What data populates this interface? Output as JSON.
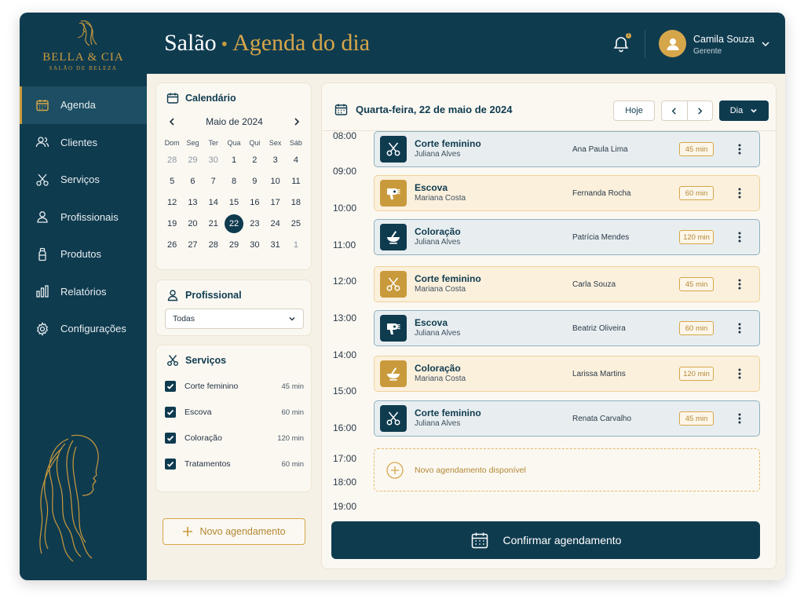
{
  "brand": {
    "name": "BELLA & CIA",
    "subtitle": "SALÃO DE BELEZA"
  },
  "nav": {
    "items": [
      {
        "label": "Agenda",
        "icon": "calendar-icon",
        "active": true
      },
      {
        "label": "Clientes",
        "icon": "users-icon"
      },
      {
        "label": "Serviços",
        "icon": "scissors-icon"
      },
      {
        "label": "Profissionais",
        "icon": "professional-icon"
      },
      {
        "label": "Produtos",
        "icon": "product-bottle-icon"
      },
      {
        "label": "Relatórios",
        "icon": "bar-chart-icon"
      },
      {
        "label": "Configurações",
        "icon": "gear-icon"
      }
    ]
  },
  "header": {
    "title_main": "Salão",
    "title_sep": "•",
    "title_accent": "Agenda do dia",
    "notification_count": "1",
    "user_name": "Camila Souza",
    "user_role": "Gerente"
  },
  "calendar": {
    "title": "Calendário",
    "month": "Maio de 2024",
    "weekdays": [
      "Dom",
      "Seg",
      "Ter",
      "Qua",
      "Qui",
      "Sex",
      "Sáb"
    ],
    "weeks": [
      [
        "28",
        "29",
        "30",
        "1",
        "2",
        "3",
        "4"
      ],
      [
        "5",
        "6",
        "7",
        "8",
        "9",
        "10",
        "11"
      ],
      [
        "12",
        "13",
        "14",
        "15",
        "16",
        "17",
        "18"
      ],
      [
        "19",
        "20",
        "21",
        "22",
        "23",
        "24",
        "25"
      ],
      [
        "26",
        "27",
        "28",
        "29",
        "30",
        "31",
        "1"
      ]
    ],
    "selected": "22"
  },
  "professional": {
    "title": "Profissional",
    "selected": "Todas"
  },
  "services_filter": {
    "title": "Serviços",
    "items": [
      {
        "name": "Corte feminino",
        "duration": "45 min",
        "checked": true
      },
      {
        "name": "Escova",
        "duration": "60 min",
        "checked": true
      },
      {
        "name": "Coloração",
        "duration": "120 min",
        "checked": true
      },
      {
        "name": "Tratamentos",
        "duration": "60 min",
        "checked": true
      }
    ]
  },
  "new_button": "Novo agendamento",
  "schedule": {
    "date": "Quarta-feira, 22 de maio de 2024",
    "today_label": "Hoje",
    "view_label": "Dia",
    "hours": [
      "08:00",
      "09:00",
      "10:00",
      "11:00",
      "12:00",
      "13:00",
      "14:00",
      "15:00",
      "16:00",
      "17:00",
      "18:00",
      "19:00"
    ],
    "appointments": [
      {
        "service": "Corte feminino",
        "professional": "Juliana Alves",
        "client": "Ana Paula Lima",
        "duration": "45 min",
        "style": "blue",
        "icon": "scissors-icon"
      },
      {
        "service": "Escova",
        "professional": "Mariana Costa",
        "client": "Fernanda Rocha",
        "duration": "60 min",
        "style": "gold",
        "icon": "hair-dryer-icon"
      },
      {
        "service": "Coloração",
        "professional": "Juliana Alves",
        "client": "Patrícia Mendes",
        "duration": "120 min",
        "style": "blue",
        "icon": "color-bowl-icon"
      },
      {
        "service": "Corte feminino",
        "professional": "Mariana Costa",
        "client": "Carla Souza",
        "duration": "45 min",
        "style": "gold",
        "icon": "scissors-icon"
      },
      {
        "service": "Escova",
        "professional": "Juliana Alves",
        "client": "Beatriz Oliveira",
        "duration": "60 min",
        "style": "blue",
        "icon": "hair-dryer-icon"
      },
      {
        "service": "Coloração",
        "professional": "Mariana Costa",
        "client": "Larissa Martins",
        "duration": "120 min",
        "style": "gold",
        "icon": "color-bowl-icon"
      },
      {
        "service": "Corte feminino",
        "professional": "Juliana Alves",
        "client": "Renata Carvalho",
        "duration": "45 min",
        "style": "blue",
        "icon": "scissors-icon"
      }
    ],
    "available_label": "Novo agendamento disponível",
    "confirm_label": "Confirmar agendamento"
  },
  "colors": {
    "primary": "#0f3b4f",
    "accent": "#c99a3c",
    "background": "#f6f1e7"
  }
}
